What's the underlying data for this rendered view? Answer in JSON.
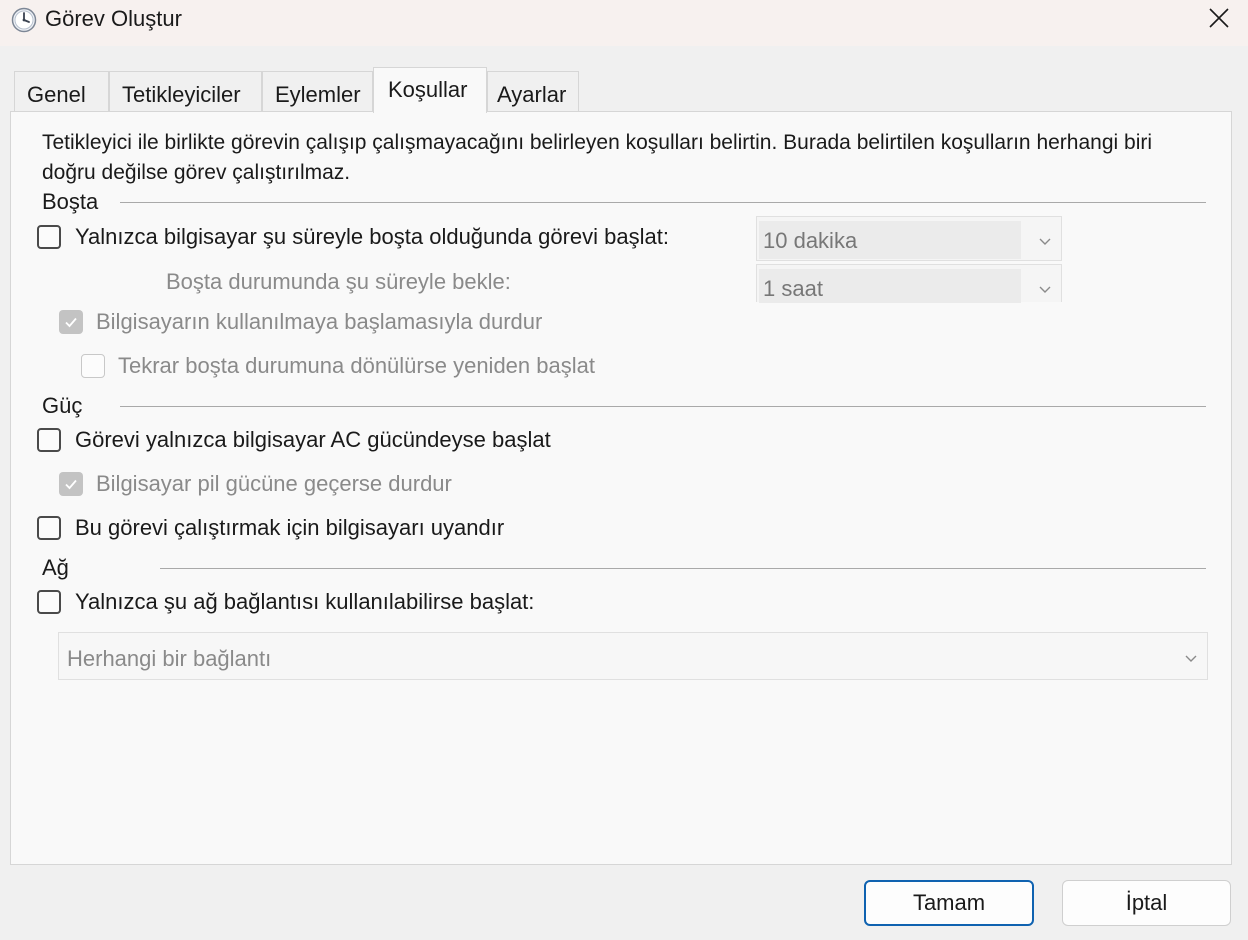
{
  "window": {
    "title": "Görev Oluştur",
    "icon": "clock-icon",
    "close_icon": "close-icon"
  },
  "tabs": [
    {
      "label": "Genel",
      "active": false
    },
    {
      "label": "Tetikleyiciler",
      "active": false
    },
    {
      "label": "Eylemler",
      "active": false
    },
    {
      "label": "Koşullar",
      "active": true
    },
    {
      "label": "Ayarlar",
      "active": false
    }
  ],
  "description": "Tetikleyici ile birlikte görevin çalışıp çalışmayacağını belirleyen koşulları belirtin. Burada belirtilen koşulların herhangi biri doğru değilse görev çalıştırılmaz.",
  "idle": {
    "section_label": "Boşta",
    "start_if_idle": {
      "label": "Yalnızca bilgisayar şu süreyle boşta olduğunda görevi başlat:",
      "checked": false
    },
    "idle_duration": {
      "value": "10 dakika"
    },
    "wait_label": "Boşta durumunda şu süreyle bekle:",
    "wait_duration": {
      "value": "1 saat"
    },
    "stop_on_use": {
      "label": "Bilgisayarın kullanılmaya başlamasıyla durdur",
      "checked": true
    },
    "restart_on_idle": {
      "label": "Tekrar boşta durumuna dönülürse yeniden başlat",
      "checked": false
    }
  },
  "power": {
    "section_label": "Güç",
    "ac_only": {
      "label": "Görevi yalnızca bilgisayar AC gücündeyse başlat",
      "checked": false
    },
    "stop_on_battery": {
      "label": "Bilgisayar pil gücüne geçerse durdur",
      "checked": true
    },
    "wake": {
      "label": "Bu görevi çalıştırmak için bilgisayarı uyandır",
      "checked": false
    }
  },
  "network": {
    "section_label": "Ağ",
    "require_network": {
      "label": "Yalnızca şu ağ bağlantısı kullanılabilirse başlat:",
      "checked": false
    },
    "connection": {
      "value": "Herhangi bir bağlantı"
    }
  },
  "buttons": {
    "ok": "Tamam",
    "cancel": "İptal"
  }
}
